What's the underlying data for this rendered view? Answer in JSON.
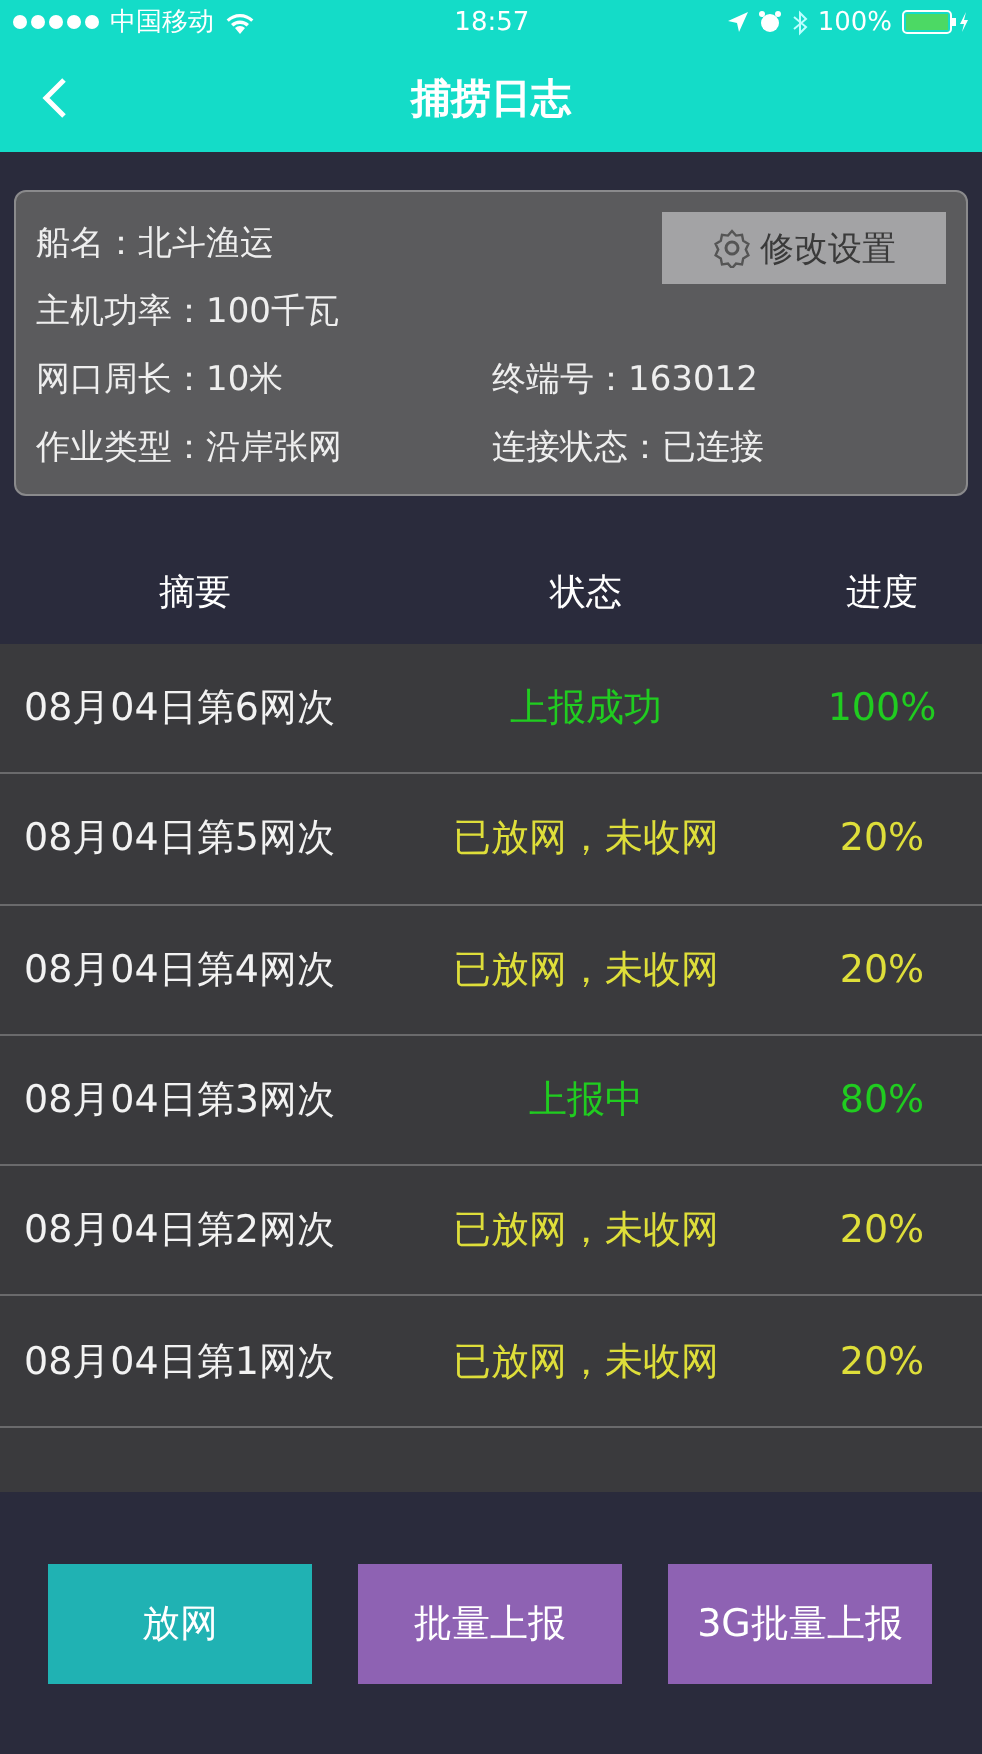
{
  "status_bar": {
    "carrier": "中国移动",
    "time": "18:57",
    "battery": "100%"
  },
  "header": {
    "title": "捕捞日志"
  },
  "info": {
    "edit_button": "修改设置",
    "fields": [
      {
        "label": "船名：",
        "value": "北斗渔运"
      },
      {
        "label": "主机功率：",
        "value": "100千瓦"
      },
      {
        "label": "网口周长：",
        "value": "10米"
      },
      {
        "label": "终端号：",
        "value": "163012"
      },
      {
        "label": "作业类型：",
        "value": "沿岸张网"
      },
      {
        "label": "连接状态：",
        "value": "已连接"
      }
    ]
  },
  "table": {
    "columns": [
      "摘要",
      "状态",
      "进度"
    ],
    "rows": [
      {
        "summary": "08月04日第6网次",
        "status": "上报成功",
        "progress": "100%",
        "kind": "reported"
      },
      {
        "summary": "08月04日第5网次",
        "status": "已放网，未收网",
        "progress": "20%",
        "kind": "pending"
      },
      {
        "summary": "08月04日第4网次",
        "status": "已放网，未收网",
        "progress": "20%",
        "kind": "pending"
      },
      {
        "summary": "08月04日第3网次",
        "status": "上报中",
        "progress": "80%",
        "kind": "reported"
      },
      {
        "summary": "08月04日第2网次",
        "status": "已放网，未收网",
        "progress": "20%",
        "kind": "pending"
      },
      {
        "summary": "08月04日第1网次",
        "status": "已放网，未收网",
        "progress": "20%",
        "kind": "pending"
      }
    ]
  },
  "buttons": [
    {
      "label": "放网",
      "kind": "primary"
    },
    {
      "label": "批量上报",
      "kind": "secondary"
    },
    {
      "label": "3G批量上报",
      "kind": "secondary"
    }
  ]
}
